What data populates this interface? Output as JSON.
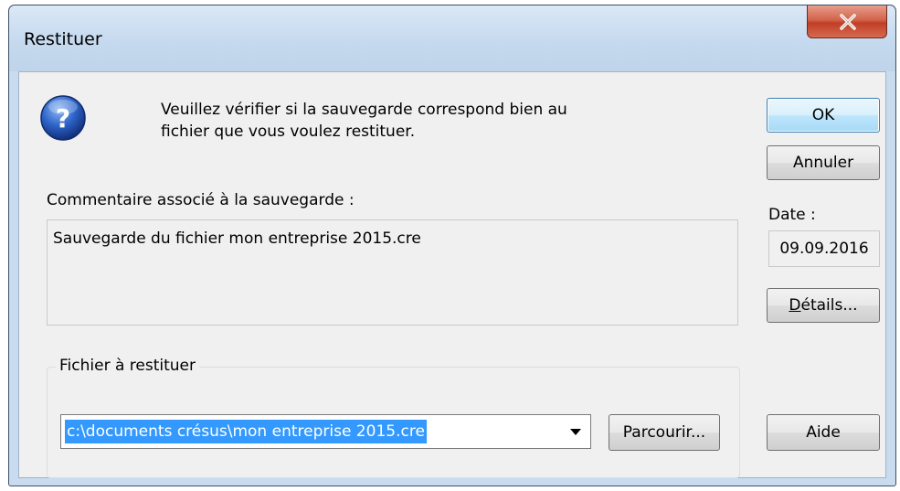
{
  "window": {
    "title": "Restituer",
    "close_label": "X"
  },
  "message": {
    "line1": "Veuillez vérifier si la sauvegarde correspond bien au",
    "line2": "fichier que vous voulez restituer."
  },
  "comment": {
    "label": "Commentaire associé à la sauvegarde :",
    "value": "Sauvegarde du fichier mon entreprise 2015.cre"
  },
  "date": {
    "label": "Date :",
    "value": "09.09.2016"
  },
  "buttons": {
    "ok": "OK",
    "cancel": "Annuler",
    "details_mnemonic": "D",
    "details_rest": "étails...",
    "browse": "Parcourir...",
    "help": "Aide"
  },
  "file_group": {
    "title": "Fichier à restituer",
    "path": "c:\\documents crésus\\mon entreprise 2015.cre"
  },
  "icons": {
    "dialog": "question-icon",
    "close": "close-icon",
    "dropdown": "chevron-down-icon"
  },
  "colors": {
    "accent": "#3399ff",
    "close_button": "#c84a30",
    "dialog_bg": "#f0f0f0"
  }
}
